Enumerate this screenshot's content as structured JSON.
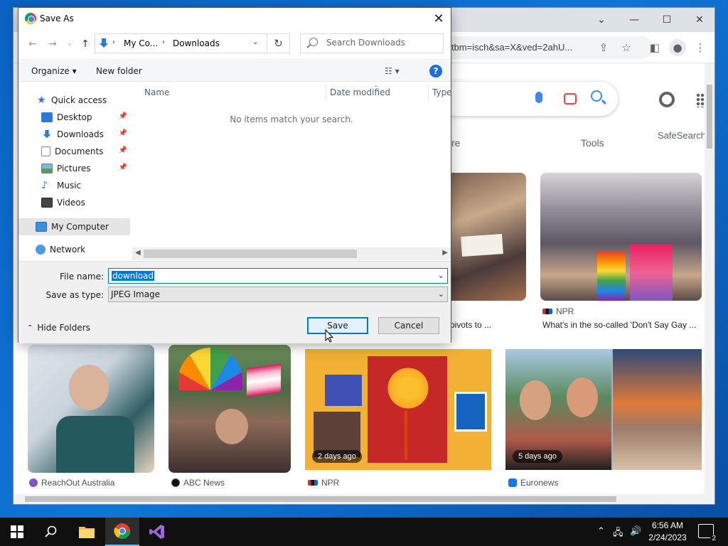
{
  "dialog": {
    "title": "Save As",
    "breadcrumb": [
      "My Co...",
      "Downloads"
    ],
    "search_placeholder": "Search Downloads",
    "commands": {
      "organize": "Organize ▾",
      "new_folder": "New folder"
    },
    "nav_items": [
      {
        "label": "Quick access"
      },
      {
        "label": "Desktop"
      },
      {
        "label": "Downloads"
      },
      {
        "label": "Documents"
      },
      {
        "label": "Pictures"
      },
      {
        "label": "Music"
      },
      {
        "label": "Videos"
      },
      {
        "label": "My Computer"
      },
      {
        "label": "Network"
      }
    ],
    "columns": {
      "name": "Name",
      "date_modified": "Date modified",
      "type": "Type"
    },
    "empty_message": "No items match your search.",
    "file_name_label": "File name:",
    "file_name_value": "download",
    "save_type_label": "Save as type:",
    "save_type_value": "JPEG Image",
    "hide_folders": "Hide Folders",
    "save_button": "Save",
    "cancel_button": "Cancel"
  },
  "browser": {
    "url_fragment": "tbm=isch&sa=X&ved=2ahU...",
    "nav_fragment_re": "re",
    "tools": "Tools",
    "safesearch": "SafeSearch",
    "results": [
      {
        "source": "NPR",
        "title": "What's in the so-called 'Don't Say Gay ..."
      },
      {
        "title_fragment": "pivots to ..."
      },
      {
        "source": "ReachOut Australia"
      },
      {
        "source": "ABC News"
      },
      {
        "source": "NPR",
        "age": "2 days ago"
      },
      {
        "source": "Euronews",
        "age": "5 days ago"
      }
    ]
  },
  "taskbar": {
    "time": "6:56 AM",
    "date": "2/24/2023",
    "notification_count": "2"
  },
  "colors": {
    "accent": "#0078d7",
    "desktop": "#0b62c4",
    "taskbar": "#101010"
  }
}
